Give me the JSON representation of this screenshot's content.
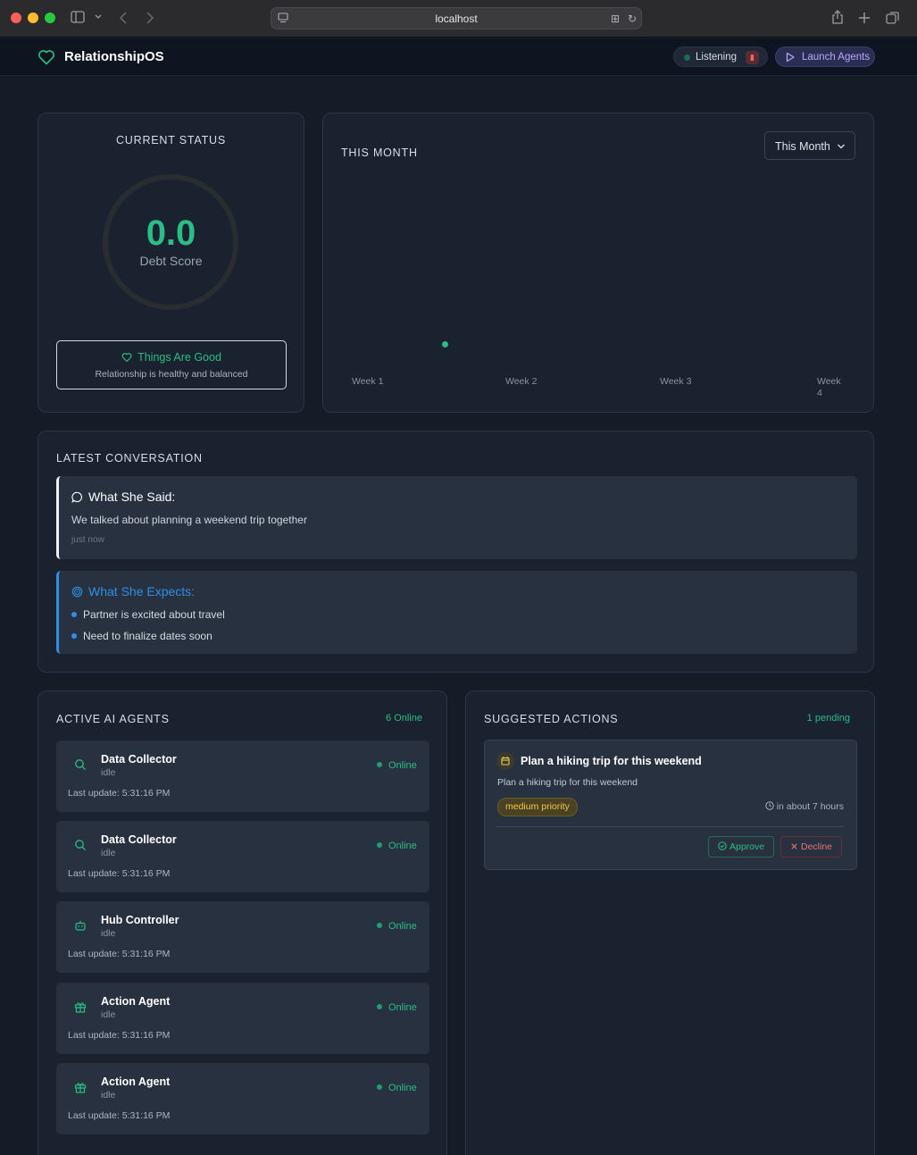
{
  "browser": {
    "url": "localhost"
  },
  "app": {
    "name": "RelationshipOS",
    "listening_label": "Listening",
    "launch_label": "Launch Agents"
  },
  "status": {
    "title": "CURRENT STATUS",
    "score": "0.0",
    "score_label": "Debt Score",
    "state_title": "Things Are Good",
    "state_subtitle": "Relationship is healthy and balanced"
  },
  "month": {
    "title": "THIS MONTH",
    "select_value": "This Month",
    "weeks": [
      "Week 1",
      "Week 2",
      "Week 3",
      "Week 4"
    ]
  },
  "chart_data": {
    "type": "scatter",
    "categories": [
      "Week 1",
      "Week 2",
      "Week 3",
      "Week 4"
    ],
    "points": [
      {
        "x": 1.57,
        "y": 0
      }
    ],
    "xlim": [
      1,
      4
    ],
    "color": "#2bbd85"
  },
  "conversation": {
    "title": "LATEST CONVERSATION",
    "said_title": "What She Said:",
    "said_text": "We talked about planning a weekend trip together",
    "said_time": "just now",
    "expects_title": "What She Expects:",
    "expects": [
      "Partner is excited about travel",
      "Need to finalize dates soon"
    ]
  },
  "agents": {
    "title": "ACTIVE AI AGENTS",
    "count": "6 Online",
    "items": [
      {
        "name": "Data Collector",
        "state": "idle",
        "status": "Online",
        "updated": "Last update: 5:31:16 PM",
        "icon": "search-icon"
      },
      {
        "name": "Data Collector",
        "state": "idle",
        "status": "Online",
        "updated": "Last update: 5:31:16 PM",
        "icon": "search-icon"
      },
      {
        "name": "Hub Controller",
        "state": "idle",
        "status": "Online",
        "updated": "Last update: 5:31:16 PM",
        "icon": "bot-icon"
      },
      {
        "name": "Action Agent",
        "state": "idle",
        "status": "Online",
        "updated": "Last update: 5:31:16 PM",
        "icon": "gift-icon"
      },
      {
        "name": "Action Agent",
        "state": "idle",
        "status": "Online",
        "updated": "Last update: 5:31:16 PM",
        "icon": "gift-icon"
      }
    ]
  },
  "actions": {
    "title": "SUGGESTED ACTIONS",
    "count": "1 pending",
    "item": {
      "title": "Plan a hiking trip for this weekend",
      "description": "Plan a hiking trip for this weekend",
      "priority": "medium priority",
      "eta": "in about 7 hours",
      "approve": "Approve",
      "decline": "Decline"
    }
  },
  "colors": {
    "accent": "#2bbd85",
    "blue": "#2f8fe6",
    "bg": "#141c28",
    "card": "#1a2230"
  }
}
